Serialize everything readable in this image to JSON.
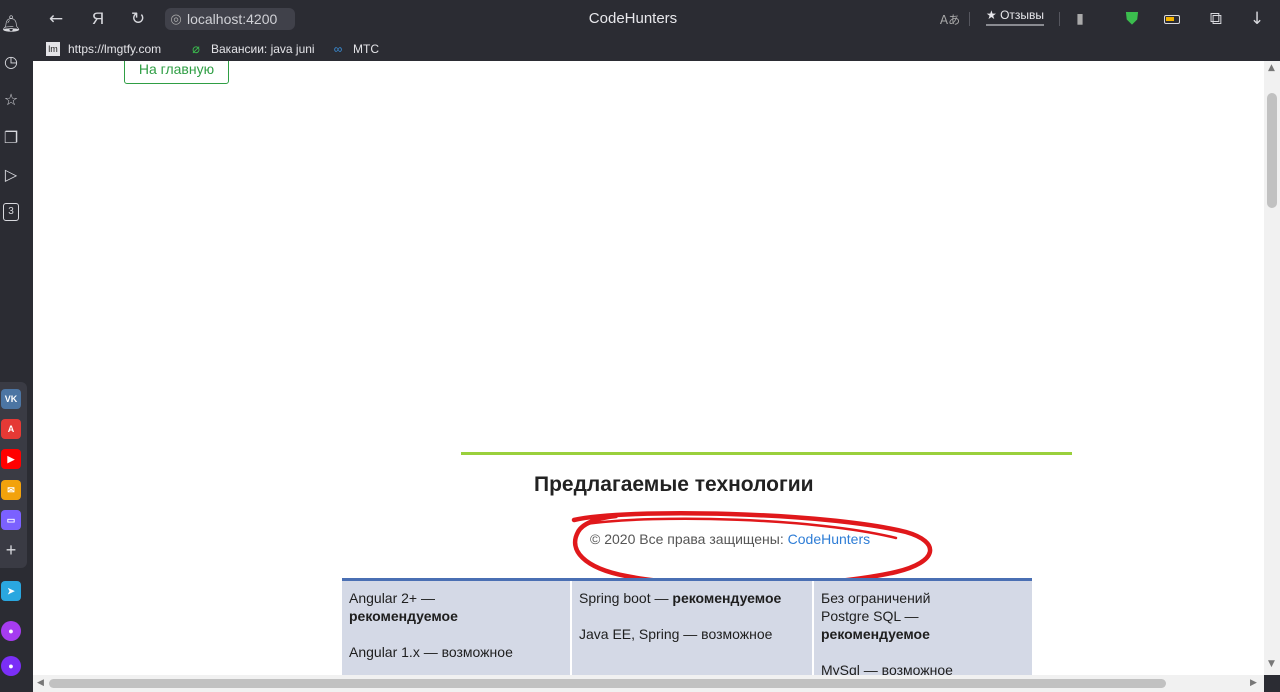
{
  "browser": {
    "url": "localhost:4200",
    "tab_title": "CodeHunters",
    "reviews_label": "★ Отзывы",
    "yandex_label": "Я"
  },
  "bookmarks": [
    {
      "label": "https://lmgtfy.com",
      "icon": "lmgtfy-icon"
    },
    {
      "label": "Вакансии: java juni",
      "icon": "paperclip-icon"
    },
    {
      "label": "МТС",
      "icon": "mts-icon"
    }
  ],
  "sidebar": {
    "tab_count": "3"
  },
  "page": {
    "home_button": "На главную",
    "tech_title": "Предлагаемые технологии",
    "copyright_text": "© 2020 Все права защищены: ",
    "copyright_link": "CodeHunters",
    "tech_table": {
      "col1": {
        "line1": "Angular 2+ —",
        "line1_bold": "рекомендуемое",
        "line2": "Angular 1.x — возможное"
      },
      "col2": {
        "line1": "Spring boot — ",
        "line1_bold": "рекомендуемое",
        "line2": "Java EE, Spring — возможное"
      },
      "col3": {
        "line1": "Без ограничений",
        "line2": "Postgre SQL —",
        "line2_bold": "рекомендуемое",
        "line3": "MySql — возможное"
      }
    }
  },
  "colors": {
    "accent_green": "#2f9e44",
    "divider_green": "#9ad03c",
    "link_blue": "#2e7dd6",
    "annotation_red": "#e0181b"
  }
}
